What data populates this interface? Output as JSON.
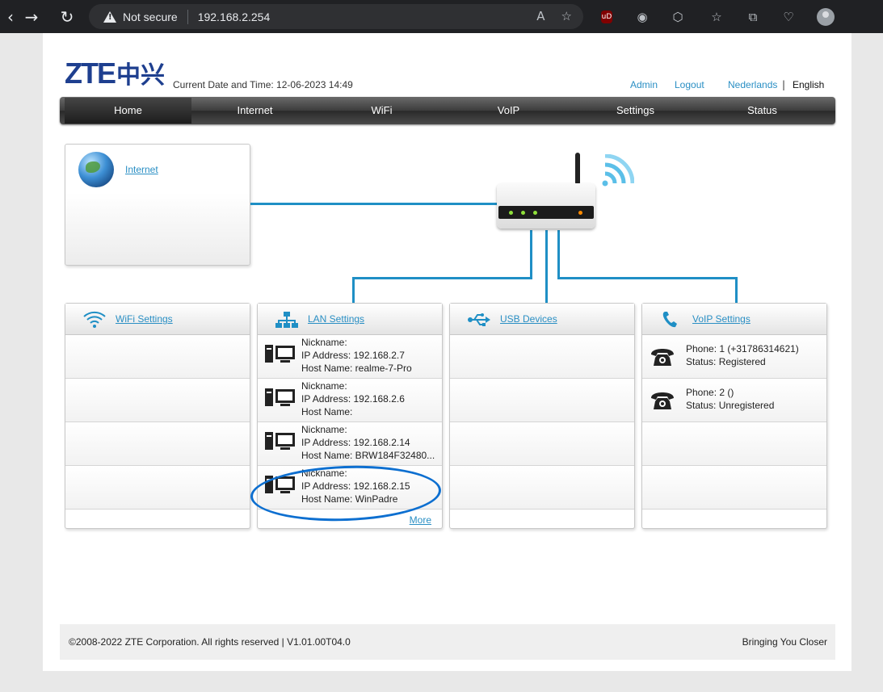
{
  "browser": {
    "security_label": "Not secure",
    "url": "192.168.2.254"
  },
  "header": {
    "logo_latin": "ZTE",
    "logo_cn": "中兴",
    "datetime": "Current Date and Time: 12-06-2023 14:49",
    "admin_link": "Admin",
    "logout_link": "Logout",
    "lang_nl": "Nederlands",
    "lang_sep": "|",
    "lang_en": "English"
  },
  "menu": [
    {
      "label": "Home",
      "active": true
    },
    {
      "label": "Internet",
      "active": false
    },
    {
      "label": "WiFi",
      "active": false
    },
    {
      "label": "VoIP",
      "active": false
    },
    {
      "label": "Settings",
      "active": false
    },
    {
      "label": "Status",
      "active": false
    }
  ],
  "internet_box": {
    "link": "Internet"
  },
  "cards": {
    "wifi": {
      "title": "WiFi Settings"
    },
    "lan": {
      "title": "LAN Settings",
      "devices": [
        {
          "nickname": "Nickname:",
          "ip": "IP Address: 192.168.2.7",
          "host": "Host Name: realme-7-Pro"
        },
        {
          "nickname": "Nickname:",
          "ip": "IP Address: 192.168.2.6",
          "host": "Host Name:"
        },
        {
          "nickname": "Nickname:",
          "ip": "IP Address: 192.168.2.14",
          "host": "Host Name: BRW184F32480..."
        },
        {
          "nickname": "Nickname:",
          "ip": "IP Address: 192.168.2.15",
          "host": "Host Name: WinPadre"
        }
      ],
      "more": "More"
    },
    "usb": {
      "title": "USB Devices"
    },
    "voip": {
      "title": "VoIP Settings",
      "phones": [
        {
          "phone": "Phone: 1 (+31786314621)",
          "status": "Status: Registered"
        },
        {
          "phone": "Phone: 2 ()",
          "status": "Status: Unregistered"
        }
      ]
    }
  },
  "footer": {
    "copyright": "©2008-2022 ZTE Corporation. All rights reserved  |   V1.01.00T04.0",
    "slogan": "Bringing You Closer"
  },
  "colors": {
    "accent": "#1f8fc5",
    "link": "#2a8fc4",
    "logo": "#1e3f8f",
    "annotation": "#0d6fd0"
  }
}
